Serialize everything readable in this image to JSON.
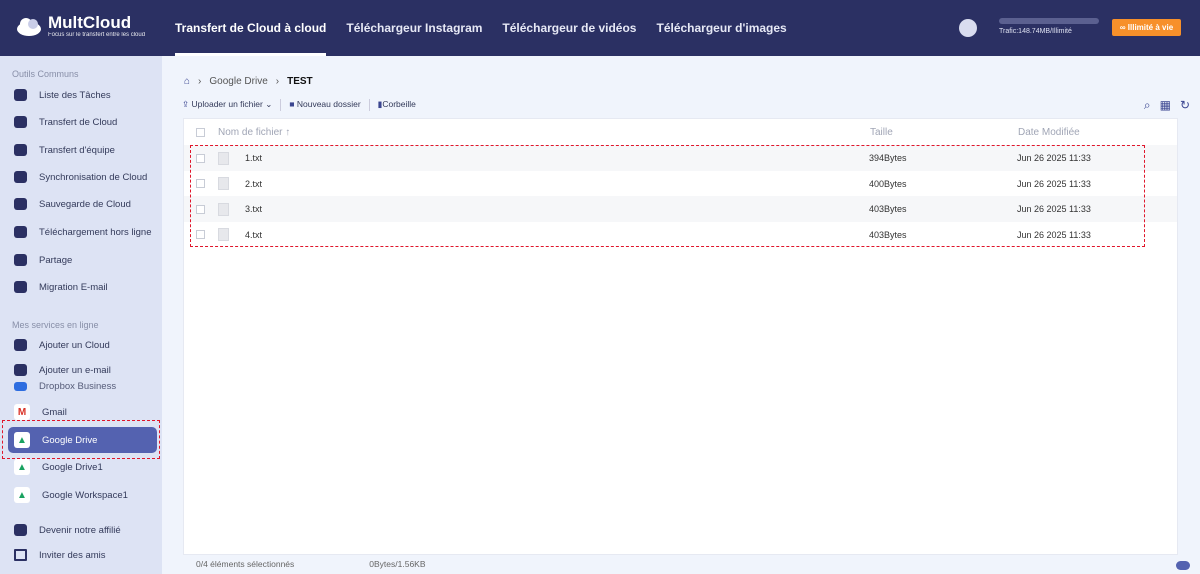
{
  "header": {
    "logo": "MultCloud",
    "tagline": "Focus sur le transfert entre les cloud",
    "nav": [
      "Transfert de Cloud à cloud",
      "Téléchargeur Instagram",
      "Téléchargeur de vidéos",
      "Téléchargeur d'images"
    ],
    "traffic": "Trafic:148.74MB/Illimité",
    "upgrade": "Illimité à vie"
  },
  "sidebar": {
    "section1": "Outils Communs",
    "tools": [
      "Liste des Tâches",
      "Transfert de Cloud",
      "Transfert d'équipe",
      "Synchronisation de Cloud",
      "Sauvegarde de Cloud",
      "Téléchargement hors ligne",
      "Partage",
      "Migration E-mail"
    ],
    "section2": "Mes services en ligne",
    "services": [
      "Ajouter un Cloud",
      "Ajouter un e-mail",
      "Dropbox Business",
      "Gmail",
      "Google Drive",
      "Google Drive1",
      "Google Workspace1"
    ],
    "bottom": [
      "Devenir notre affilié",
      "Inviter des amis"
    ],
    "selected": "Google Drive"
  },
  "breadcrumb": [
    "Google Drive",
    "TEST"
  ],
  "toolbar": {
    "upload": "Uploader un fichier",
    "new_folder": "Nouveau dossier",
    "trash": "Corbeille"
  },
  "table": {
    "headers": [
      "Nom de fichier",
      "Taille",
      "Date Modifiée"
    ],
    "rows": [
      {
        "name": "1.txt",
        "size": "394Bytes",
        "date": "Jun 26 2025 11:33"
      },
      {
        "name": "2.txt",
        "size": "400Bytes",
        "date": "Jun 26 2025 11:33"
      },
      {
        "name": "3.txt",
        "size": "403Bytes",
        "date": "Jun 26 2025 11:33"
      },
      {
        "name": "4.txt",
        "size": "403Bytes",
        "date": "Jun 26 2025 11:33"
      }
    ]
  },
  "footer": {
    "selected": "0/4 éléments sélectionnés",
    "size": "0Bytes/1.56KB"
  },
  "colors": {
    "header": "#2b3063",
    "accent": "#5462b0",
    "upgrade": "#f7902a",
    "highlight": "#e0162b"
  }
}
